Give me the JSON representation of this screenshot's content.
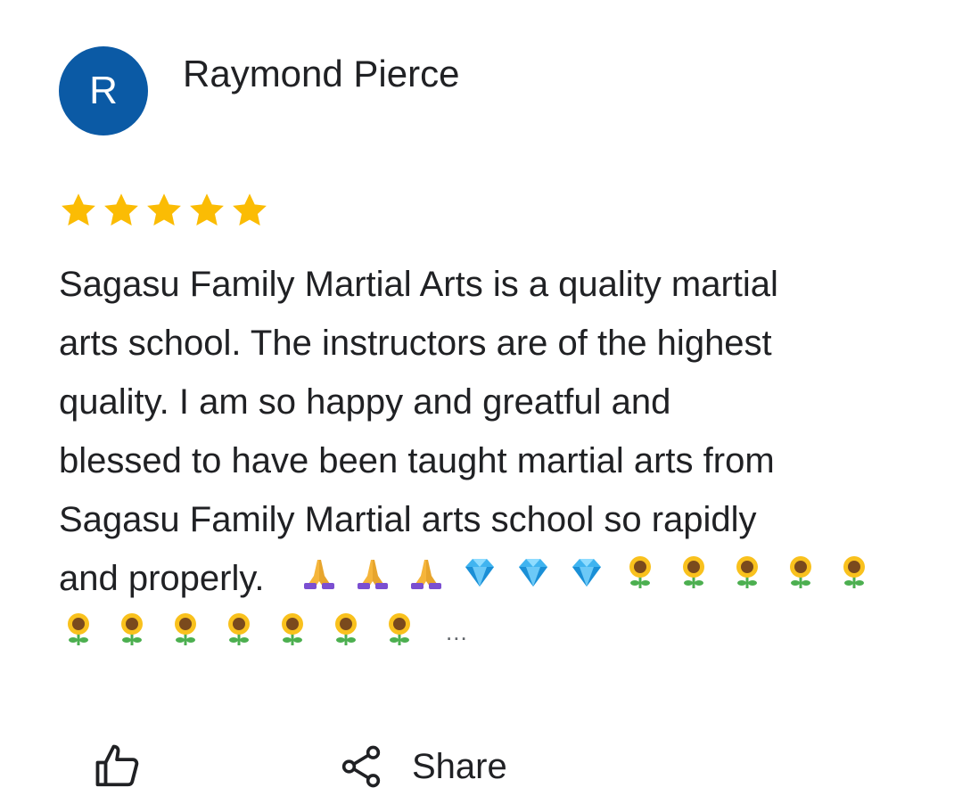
{
  "reviewer": {
    "avatar_letter": "R",
    "avatar_color": "#0b5aa5",
    "name": "Raymond Pierce"
  },
  "rating": {
    "stars": 5,
    "max": 5,
    "star_color": "#fbbc04"
  },
  "review": {
    "lines": [
      "Sagasu Family Martial Arts is a quality martial",
      "arts school. The instructors are of the highest",
      "quality. I  am so happy and greatful and",
      "blessed to have been taught martial arts from",
      "Sagasu Family Martial arts school so rapidly",
      "and properly."
    ],
    "emoji_row1": [
      "folded-hands-icon",
      "folded-hands-icon",
      "folded-hands-icon",
      "gem-icon",
      "gem-icon",
      "gem-icon",
      "sunflower-icon",
      "sunflower-icon",
      "sunflower-icon",
      "sunflower-icon",
      "sunflower-icon"
    ],
    "emoji_row2": [
      "sunflower-icon",
      "sunflower-icon",
      "sunflower-icon",
      "sunflower-icon",
      "sunflower-icon",
      "sunflower-icon",
      "sunflower-icon"
    ],
    "truncation": "..."
  },
  "actions": {
    "like_icon": "thumbs-up-icon",
    "share_icon": "share-icon",
    "share_label": "Share"
  }
}
